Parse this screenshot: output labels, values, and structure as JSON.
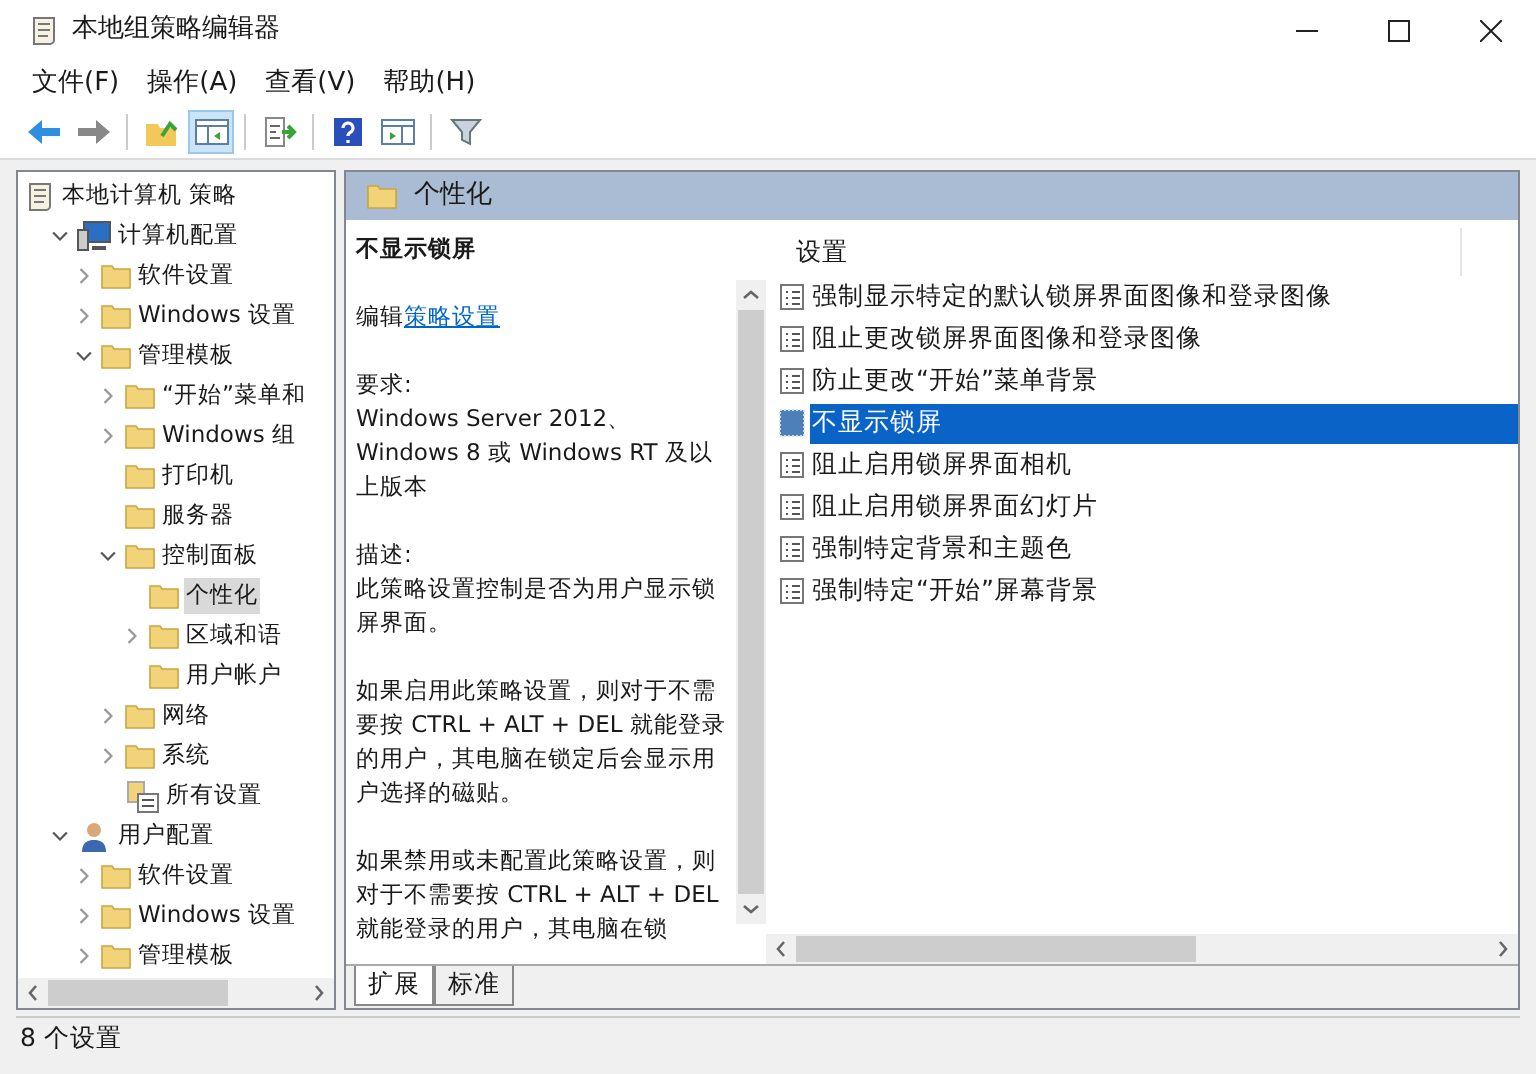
{
  "window": {
    "title": "本地组策略编辑器"
  },
  "menu": [
    "文件(F)",
    "操作(A)",
    "查看(V)",
    "帮助(H)"
  ],
  "toolbar": [
    {
      "kind": "back",
      "pressed": false
    },
    {
      "kind": "forward",
      "pressed": false
    },
    {
      "kind": "separator"
    },
    {
      "kind": "up",
      "pressed": false
    },
    {
      "kind": "tree",
      "pressed": true
    },
    {
      "kind": "separator"
    },
    {
      "kind": "export",
      "pressed": false
    },
    {
      "kind": "separator"
    },
    {
      "kind": "help",
      "pressed": false
    },
    {
      "kind": "view",
      "pressed": false
    },
    {
      "kind": "separator"
    },
    {
      "kind": "filter",
      "pressed": false
    }
  ],
  "tree": [
    {
      "label": "本地计算机 策略",
      "kind": "policy",
      "selected": false,
      "children": [
        {
          "label": "计算机配置",
          "kind": "computer",
          "expanded": true,
          "selected": false,
          "children": [
            {
              "label": "软件设置",
              "kind": "folder",
              "expanded": false,
              "selected": false
            },
            {
              "label": "Windows 设置",
              "kind": "folder",
              "expanded": false,
              "selected": false
            },
            {
              "label": "管理模板",
              "kind": "folder",
              "expanded": true,
              "selected": false,
              "children": [
                {
                  "label": "“开始”菜单和",
                  "kind": "folder",
                  "expanded": false,
                  "selected": false
                },
                {
                  "label": "Windows 组",
                  "kind": "folder",
                  "expanded": false,
                  "selected": false
                },
                {
                  "label": "打印机",
                  "kind": "folder",
                  "selected": false
                },
                {
                  "label": "服务器",
                  "kind": "folder",
                  "selected": false
                },
                {
                  "label": "控制面板",
                  "kind": "folder",
                  "expanded": true,
                  "selected": false,
                  "children": [
                    {
                      "label": "个性化",
                      "kind": "folder",
                      "selected": true
                    },
                    {
                      "label": "区域和语",
                      "kind": "folder",
                      "expanded": false,
                      "selected": false
                    },
                    {
                      "label": "用户帐户",
                      "kind": "folder",
                      "selected": false
                    }
                  ]
                },
                {
                  "label": "网络",
                  "kind": "folder",
                  "expanded": false,
                  "selected": false
                },
                {
                  "label": "系统",
                  "kind": "folder",
                  "expanded": false,
                  "selected": false
                },
                {
                  "label": "所有设置",
                  "kind": "settings",
                  "selected": false
                }
              ]
            }
          ]
        },
        {
          "label": "用户配置",
          "kind": "user",
          "expanded": true,
          "selected": false,
          "children": [
            {
              "label": "软件设置",
              "kind": "folder",
              "expanded": false,
              "selected": false
            },
            {
              "label": "Windows 设置",
              "kind": "folder",
              "expanded": false,
              "selected": false
            },
            {
              "label": "管理模板",
              "kind": "folder",
              "expanded": false,
              "selected": false
            }
          ]
        }
      ]
    }
  ],
  "pane_header": {
    "title": "个性化"
  },
  "description": {
    "title": "不显示锁屏",
    "edit_prefix": "编辑",
    "edit_link": "策略设置",
    "sections": [
      {
        "heading": "要求:",
        "text": "Windows Server 2012、 Windows 8 或 Windows RT 及以上版本"
      },
      {
        "heading": "描述:",
        "text": "此策略设置控制是否为用户显示锁屏界面。"
      },
      {
        "text": "如果启用此策略设置，则对于不需要按 CTRL + ALT + DEL  就能登录的用户，其电脑在锁定后会显示用户选择的磁贴。"
      },
      {
        "text": "如果禁用或未配置此策略设置，则对于不需要按 CTRL + ALT + DEL 就能登录的用户，其电脑在锁"
      }
    ]
  },
  "list": {
    "column": "设置",
    "rows": [
      {
        "label": "强制显示特定的默认锁屏界面图像和登录图像",
        "selected": false
      },
      {
        "label": "阻止更改锁屏界面图像和登录图像",
        "selected": false
      },
      {
        "label": "防止更改“开始”菜单背景",
        "selected": false
      },
      {
        "label": "不显示锁屏",
        "selected": true
      },
      {
        "label": "阻止启用锁屏界面相机",
        "selected": false
      },
      {
        "label": "阻止启用锁屏界面幻灯片",
        "selected": false
      },
      {
        "label": "强制特定背景和主题色",
        "selected": false
      },
      {
        "label": "强制特定“开始”屏幕背景",
        "selected": false
      }
    ]
  },
  "tabs": [
    {
      "label": "扩展",
      "selected": true
    },
    {
      "label": "标准",
      "selected": false
    }
  ],
  "status_bar": "8 个设置"
}
